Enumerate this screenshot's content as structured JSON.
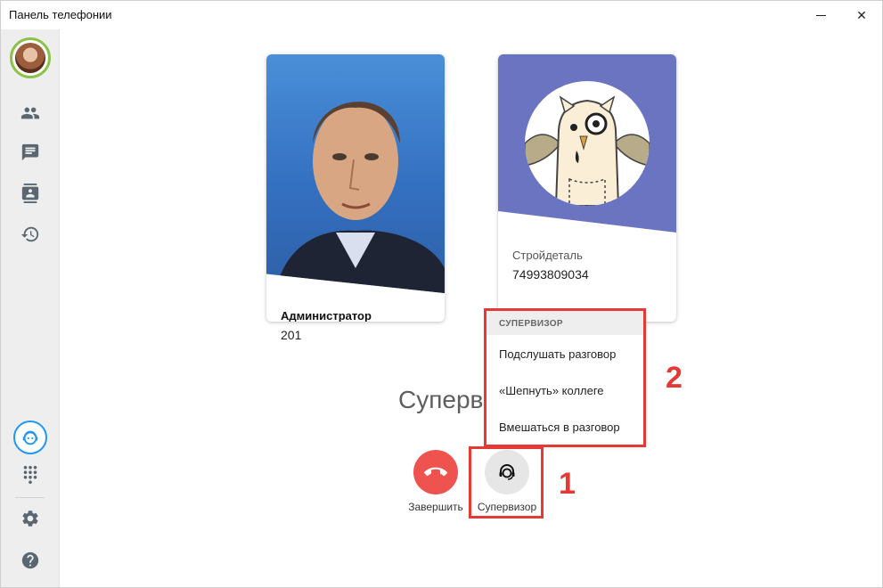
{
  "window": {
    "title": "Панель телефонии",
    "minimize_icon": "minimize-icon",
    "close_glyph": "✕"
  },
  "sidebar": {
    "items": [
      {
        "name": "contacts-group-icon"
      },
      {
        "name": "chat-icon"
      },
      {
        "name": "address-book-icon"
      },
      {
        "name": "history-icon"
      }
    ],
    "support_icon": "support-agent-icon",
    "bottom": [
      {
        "name": "dialpad-icon"
      },
      {
        "name": "settings-icon"
      },
      {
        "name": "help-icon"
      }
    ]
  },
  "participants": [
    {
      "name": "Администратор",
      "number": "201"
    },
    {
      "name": "Стройдеталь",
      "number": "74993809034"
    }
  ],
  "status": {
    "text": "Суперв"
  },
  "actions": {
    "hangup_label": "Завершить",
    "supervisor_label": "Супервизор"
  },
  "supervisor_menu": {
    "header": "СУПЕРВИЗОР",
    "items": [
      "Подслушать разговор",
      "«Шепнуть» коллеге",
      "Вмешаться в разговор"
    ]
  },
  "annotations": {
    "marker1": "1",
    "marker2": "2"
  },
  "colors": {
    "accent": "#2196f3",
    "danger": "#ef5350",
    "highlight": "#e53935",
    "online": "#8bc34a"
  }
}
